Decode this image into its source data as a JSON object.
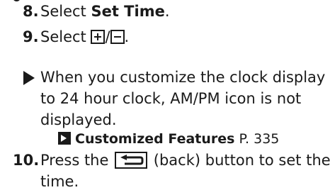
{
  "steps": [
    {
      "number": "8.",
      "prefix": "Select ",
      "bold": "Set Time",
      "suffix": "."
    },
    {
      "number": "9.",
      "prefix": "Select ",
      "separator": "/",
      "suffix": "."
    },
    {
      "number": "10.",
      "prefix": "Press the ",
      "suffix_line1": " (back) button to set the",
      "line2": "time."
    }
  ],
  "note": {
    "line1": "When you customize the clock display",
    "line2": "to 24 hour clock, AM/PM icon is not",
    "line3": "displayed."
  },
  "reference": {
    "title": "Customized Features",
    "page": "P. 335"
  },
  "icons": {
    "plus": "plus-box-icon",
    "minus": "minus-box-icon",
    "back": "back-button-icon",
    "note_marker": "triangle-marker-icon",
    "reference": "cross-reference-icon"
  }
}
